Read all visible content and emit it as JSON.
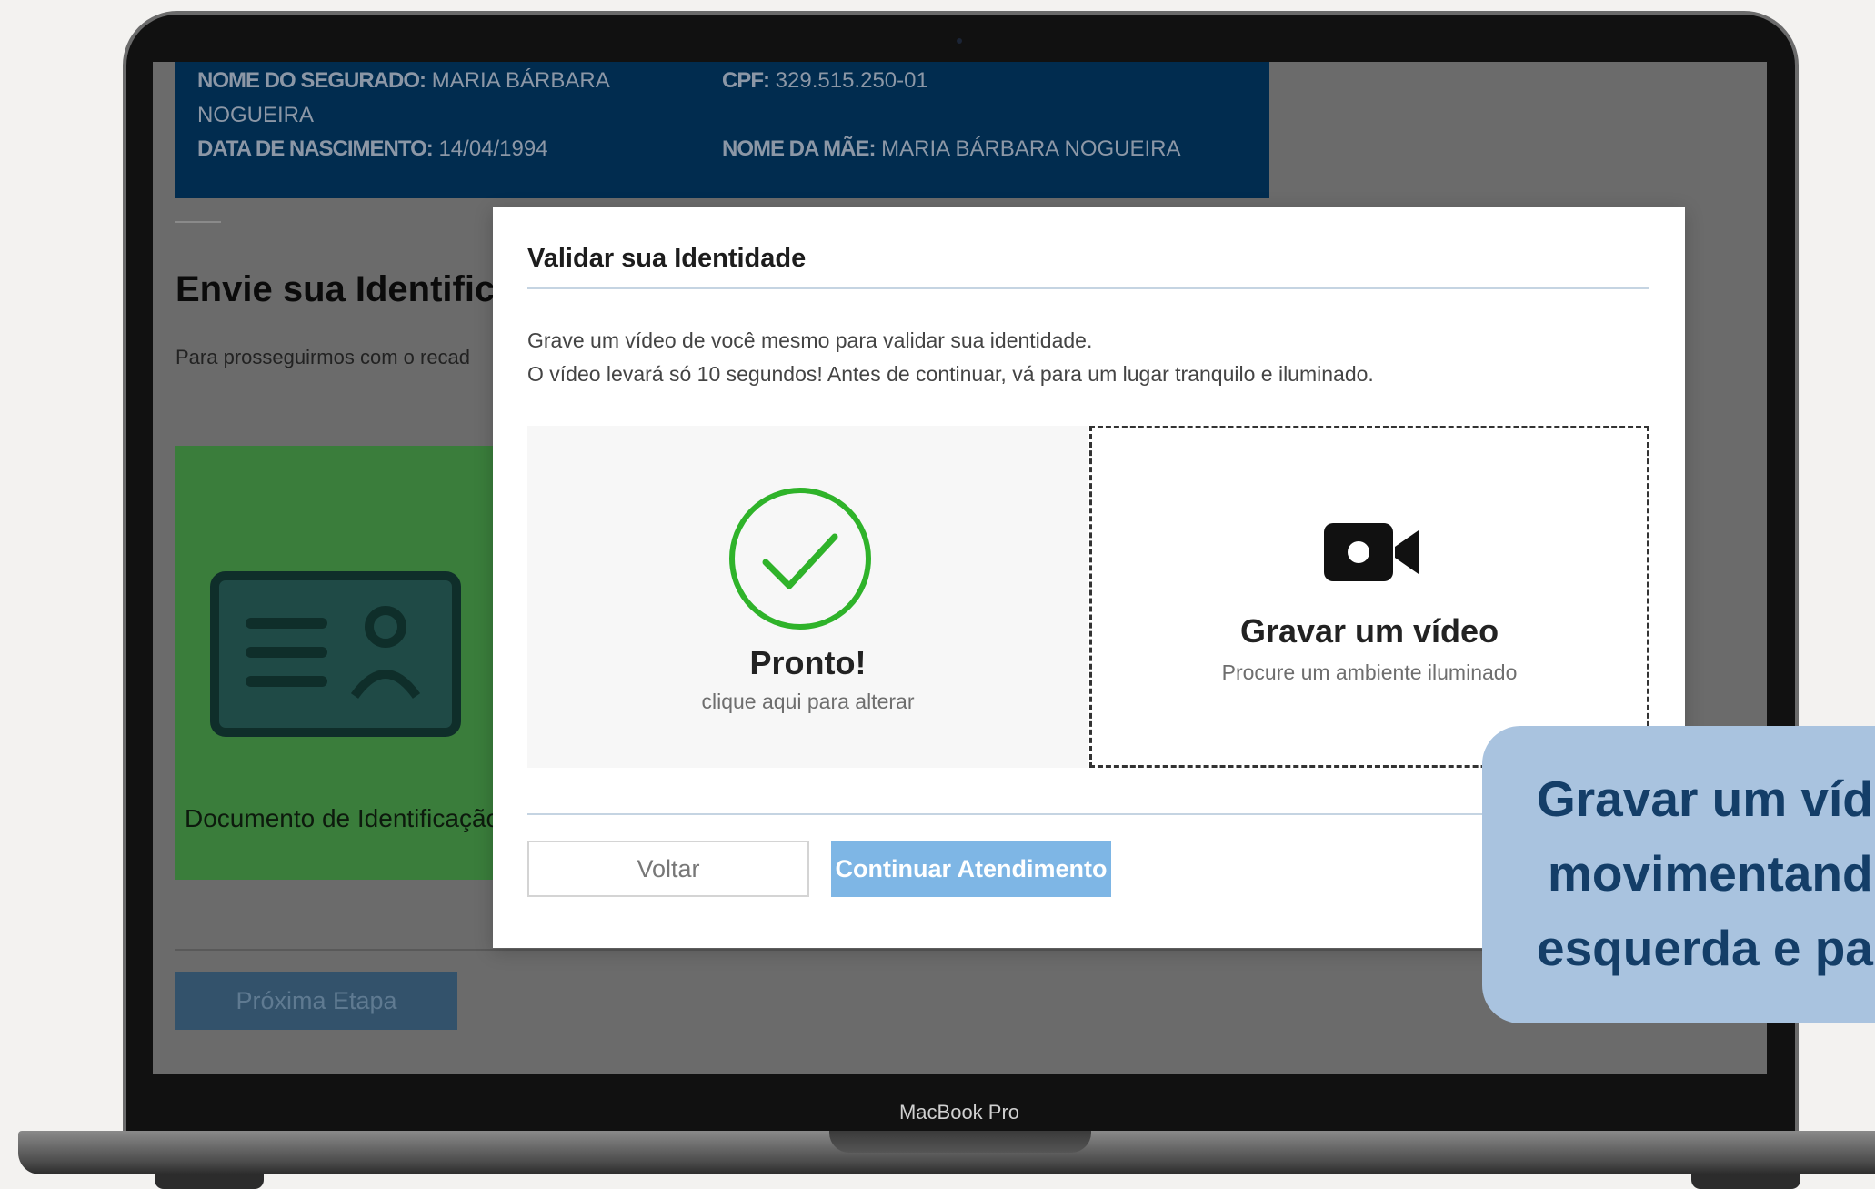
{
  "device": {
    "label": "MacBook Pro"
  },
  "info": {
    "insured_name_label": "NOME DO SEGURADO:",
    "insured_name_value_line1": "MARIA BÁRBARA",
    "insured_name_value_line2": "NOGUEIRA",
    "cpf_label": "CPF:",
    "cpf_value": "329.515.250-01",
    "birth_label": "DATA DE NASCIMENTO:",
    "birth_value": "14/04/1994",
    "mother_label": "NOME DA MÃE:",
    "mother_value": "MARIA BÁRBARA NOGUEIRA"
  },
  "page": {
    "title": "Envie sua Identific",
    "subtitle": "Para prosseguirmos com o recad",
    "doc_card_label": "Documento de Identificação",
    "next_button": "Próxima Etapa"
  },
  "modal": {
    "title": "Validar sua Identidade",
    "text_line1": "Grave um vídeo de você mesmo para validar sua identidade.",
    "text_line2": "O vídeo levará só 10 segundos! Antes de continuar, vá para um lugar tranquilo e iluminado.",
    "option_done": {
      "title": "Pronto!",
      "subtitle": "clique aqui para alterar",
      "icon": "check-circle-icon"
    },
    "option_record": {
      "title": "Gravar um vídeo",
      "subtitle": "Procure um ambiente iluminado",
      "icon": "video-camera-icon"
    },
    "back_button": "Voltar",
    "continue_button": "Continuar Atendimento"
  },
  "callout": {
    "line1": "Gravar um víd",
    "line2": "movimentand",
    "line3": "esquerda e pa"
  },
  "colors": {
    "info_bar": "#012c4f",
    "success_green": "#2fb32a",
    "primary_button": "#7eb6e5",
    "callout_bg": "#a9c3df",
    "callout_text": "#143e68"
  }
}
